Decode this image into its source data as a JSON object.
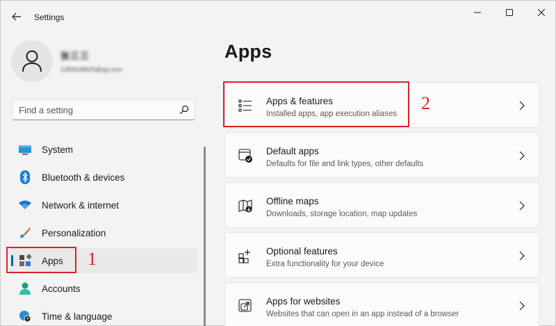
{
  "window": {
    "title": "Settings"
  },
  "user": {
    "name": "张三三",
    "email": "1383628825@qq.com"
  },
  "search": {
    "placeholder": "Find a setting"
  },
  "sidebar": {
    "items": [
      {
        "label": "System",
        "icon": "monitor-icon"
      },
      {
        "label": "Bluetooth & devices",
        "icon": "bluetooth-icon"
      },
      {
        "label": "Network & internet",
        "icon": "wifi-icon"
      },
      {
        "label": "Personalization",
        "icon": "brush-icon"
      },
      {
        "label": "Apps",
        "icon": "apps-icon",
        "selected": true
      },
      {
        "label": "Accounts",
        "icon": "person-icon"
      },
      {
        "label": "Time & language",
        "icon": "globe-clock-icon"
      }
    ]
  },
  "main": {
    "heading": "Apps",
    "cards": [
      {
        "title": "Apps & features",
        "desc": "Installed apps, app execution aliases",
        "icon": "list-icon"
      },
      {
        "title": "Default apps",
        "desc": "Defaults for file and link types, other defaults",
        "icon": "default-apps-icon"
      },
      {
        "title": "Offline maps",
        "desc": "Downloads, storage location, map updates",
        "icon": "map-icon"
      },
      {
        "title": "Optional features",
        "desc": "Extra functionality for your device",
        "icon": "add-feature-icon"
      },
      {
        "title": "Apps for websites",
        "desc": "Websites that can open in an app instead of a browser",
        "icon": "open-external-icon"
      }
    ]
  },
  "annotations": {
    "step1": "1",
    "step2": "2"
  },
  "colors": {
    "accent": "#005fb8",
    "annotation": "#d8232a"
  }
}
